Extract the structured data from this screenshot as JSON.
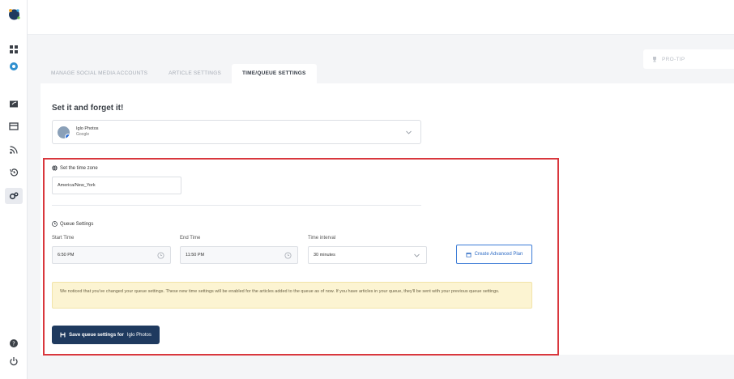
{
  "tabs": [
    {
      "label": "MANAGE SOCIAL MEDIA ACCOUNTS"
    },
    {
      "label": "ARTICLE SETTINGS"
    },
    {
      "label": "TIME/QUEUE SETTINGS"
    }
  ],
  "protip": {
    "label": "PRO-TIP"
  },
  "main": {
    "title": "Set it and forget it!",
    "account": {
      "name": "Iglo Photos",
      "network": "Google"
    },
    "timezone": {
      "label": "Set the time zone",
      "value": "America/New_York"
    },
    "queue": {
      "label": "Queue Settings",
      "start_label": "Start Time",
      "start_value": "6:50 PM",
      "end_label": "End Time",
      "end_value": "11:50 PM",
      "interval_label": "Time interval",
      "interval_value": "30 minutes"
    },
    "advanced_button": "Create Advanced Plan",
    "notice": "We noticed that you've changed your queue settings. These new time settings will be enabled for the articles added to the queue as of now. If you have articles in your queue, they'll be sent with your previous queue settings.",
    "save_button_prefix": "Save queue settings for",
    "save_button_account": "Iglo Photos"
  },
  "colors": {
    "accent": "#1f3a5f",
    "highlight": "#d9373d",
    "notice_bg": "#fcf4d2"
  }
}
